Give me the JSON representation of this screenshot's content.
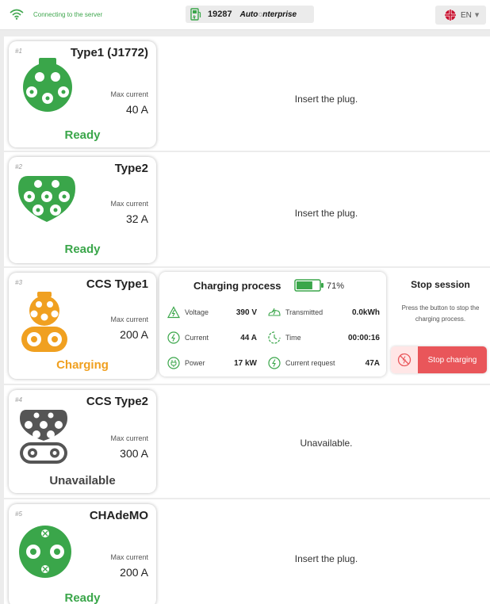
{
  "header": {
    "connection_text": "Connecting to the server",
    "station_id": "19287",
    "brand": "Auto◌nterprise",
    "language": "EN",
    "wifi_icon": "wifi-icon",
    "station_icon": "charging-station-icon",
    "flag_icon": "uk-flag-icon"
  },
  "connectors": [
    {
      "num": "#1",
      "title": "Type1 (J1772)",
      "max_label": "Max current",
      "max_value": "40 A",
      "status": "Ready",
      "message": "Insert the plug.",
      "icon": "type1-plug-icon"
    },
    {
      "num": "#2",
      "title": "Type2",
      "max_label": "Max current",
      "max_value": "32 A",
      "status": "Ready",
      "message": "Insert the plug.",
      "icon": "type2-plug-icon"
    },
    {
      "num": "#3",
      "title": "CCS Type1",
      "max_label": "Max current",
      "max_value": "200 A",
      "status": "Charging",
      "icon": "ccs-type1-plug-icon"
    },
    {
      "num": "#4",
      "title": "CCS Type2",
      "max_label": "Max current",
      "max_value": "300 A",
      "status": "Unavailable",
      "message": "Unavailable.",
      "icon": "ccs-type2-plug-icon"
    },
    {
      "num": "#5",
      "title": "CHAdeMO",
      "max_label": "Max current",
      "max_value": "200 A",
      "status": "Ready",
      "message": "Insert the plug.",
      "icon": "chademo-plug-icon"
    }
  ],
  "charging": {
    "title": "Charging process",
    "battery_percent": "71%",
    "battery_level": 0.71,
    "metrics": {
      "voltage": {
        "label": "Voltage",
        "value": "390 V"
      },
      "transmitted": {
        "label": "Transmitted",
        "value": "0.0kWh"
      },
      "current": {
        "label": "Current",
        "value": "44 A"
      },
      "time": {
        "label": "Time",
        "value": "00:00:16"
      },
      "power": {
        "label": "Power",
        "value": "17 kW"
      },
      "current_request": {
        "label": "Current request",
        "value": "47A"
      }
    }
  },
  "stop_session": {
    "title": "Stop session",
    "description": "Press the button to stop the charging process.",
    "button_label": "Stop charging"
  },
  "colors": {
    "ready": "#3aa64a",
    "charging": "#f0a020",
    "unavailable": "#555555",
    "stop_button": "#e9565a",
    "battery_fill": "#3aa64a"
  }
}
